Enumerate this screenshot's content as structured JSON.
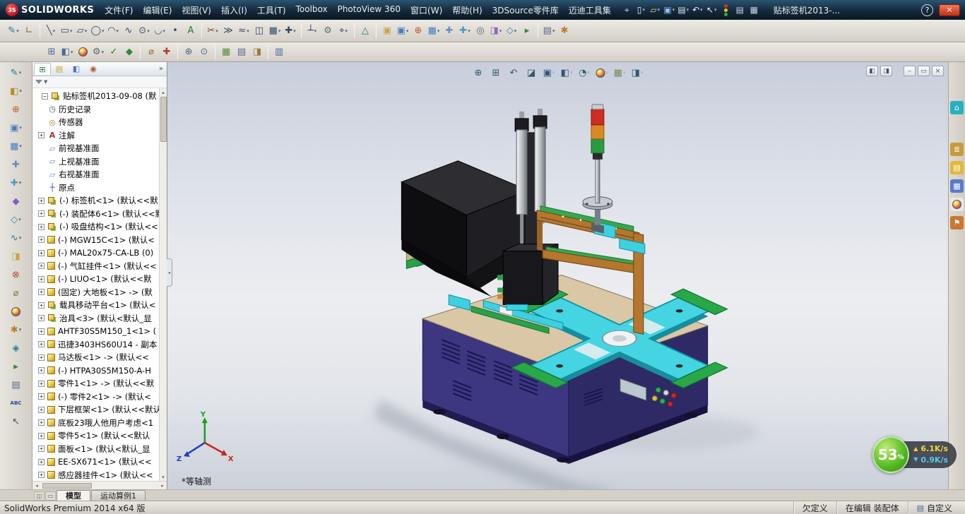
{
  "titlebar": {
    "logo_mark": "3S",
    "logo_text": "SOLIDWORKS",
    "menus": [
      "文件(F)",
      "编辑(E)",
      "视图(V)",
      "插入(I)",
      "工具(T)",
      "Toolbox",
      "PhotoView 360",
      "窗口(W)",
      "帮助(H)",
      "3DSource零件库",
      "迈迪工具集"
    ],
    "quick_icons": [
      {
        "n": "pin-icon",
        "g": "⌖",
        "c": "#cdd6de"
      },
      {
        "n": "new-document-button",
        "g": "▯",
        "c": "#f2f4f6",
        "d": 1
      },
      {
        "n": "open-button",
        "g": "▱",
        "c": "#f0d080",
        "d": 1
      },
      {
        "n": "save-button",
        "g": "▣",
        "c": "#8ec0f0",
        "d": 1
      },
      {
        "n": "print-button",
        "g": "▤",
        "c": "#dfe5ea",
        "d": 1
      },
      {
        "n": "undo-button",
        "g": "↶",
        "c": "#e8eef2",
        "d": 1
      },
      {
        "n": "select-button",
        "g": "↖",
        "c": "#f2f4f6",
        "d": 1
      },
      {
        "n": "rebuild-button",
        "g": "STOPLIGHT",
        "c": ""
      },
      {
        "n": "file-properties-button",
        "g": "▤",
        "c": "#c8d4de"
      },
      {
        "n": "toolbox-browser-button",
        "g": "▦",
        "c": "#c8d4de"
      }
    ],
    "doc_title": "贴标签机2013-...",
    "help_label": "?",
    "close_label": "×"
  },
  "toolbar_row1": [
    {
      "n": "sketch-button",
      "g": "✎",
      "c": "#177a9a",
      "d": 1
    },
    {
      "n": "smart-dimension-button",
      "g": "∟",
      "c": "#8a6a2a"
    },
    {
      "sep": 1
    },
    {
      "n": "line-button",
      "g": "╲",
      "c": "#33486a",
      "d": 1
    },
    {
      "n": "corner-rectangle-button",
      "g": "▭",
      "c": "#33486a",
      "d": 1
    },
    {
      "n": "straight-slot-button",
      "g": "▱",
      "c": "#33486a",
      "d": 1
    },
    {
      "n": "circle-button",
      "g": "◯",
      "c": "#33486a",
      "d": 1
    },
    {
      "n": "centerpoint-arc-button",
      "g": "◠",
      "c": "#33486a",
      "d": 1
    },
    {
      "n": "spline-button",
      "g": "∿",
      "c": "#33486a"
    },
    {
      "n": "ellipse-button",
      "g": "⊙",
      "c": "#33486a",
      "d": 1
    },
    {
      "n": "sketch-fillet-button",
      "g": "◡",
      "c": "#33486a",
      "d": 1
    },
    {
      "n": "point-button",
      "g": "•",
      "c": "#33486a"
    },
    {
      "n": "text-button",
      "g": "A",
      "c": "#2a7a3a"
    },
    {
      "sep": 1
    },
    {
      "n": "trim-entities-button",
      "g": "✂",
      "c": "#8a3a2a",
      "d": 1
    },
    {
      "n": "convert-entities-button",
      "g": "≫",
      "c": "#33486a"
    },
    {
      "n": "offset-entities-button",
      "g": "≈",
      "c": "#33486a",
      "d": 1
    },
    {
      "n": "mirror-entities-button",
      "g": "◫",
      "c": "#33486a"
    },
    {
      "n": "linear-sketch-pattern-button",
      "g": "▦",
      "c": "#33486a",
      "d": 1
    },
    {
      "n": "move-entities-button",
      "g": "✚",
      "c": "#33486a",
      "d": 1
    },
    {
      "sep": 1
    },
    {
      "n": "display-relations-button",
      "g": "┴",
      "c": "#33486a",
      "d": 1
    },
    {
      "n": "repair-sketch-button",
      "g": "⚙",
      "c": "#66707a"
    },
    {
      "n": "quick-snaps-button",
      "g": "⌖",
      "c": "#33486a",
      "d": 1
    },
    {
      "sep": 1
    },
    {
      "n": "rapid-sketch-button",
      "g": "△",
      "c": "#2a7a4a"
    },
    {
      "sep": 1
    },
    {
      "n": "edit-component-button",
      "g": "▣",
      "c": "#caa24a"
    },
    {
      "n": "insert-components-button",
      "g": "▣",
      "c": "#4a7ac0",
      "d": 1
    },
    {
      "n": "mate-button",
      "g": "⊕",
      "c": "#c05a2a"
    },
    {
      "n": "linear-component-pattern-button",
      "g": "▦",
      "c": "#4a7ac0",
      "d": 1
    },
    {
      "n": "smart-fasteners-button",
      "g": "✚",
      "c": "#6a8ac0"
    },
    {
      "n": "move-component-button",
      "g": "✚",
      "c": "#4a9ac0",
      "d": 1
    },
    {
      "n": "show-hidden-components-button",
      "g": "◎",
      "c": "#556070"
    },
    {
      "n": "assembly-features-button",
      "g": "◨",
      "c": "#8a6ac0",
      "d": 1
    },
    {
      "n": "reference-geometry-button",
      "g": "◇",
      "c": "#3a8a9a",
      "d": 1
    },
    {
      "n": "new-motion-study-button",
      "g": "▸",
      "c": "#2a8a3a"
    },
    {
      "sep": 1
    },
    {
      "n": "bill-of-materials-button",
      "g": "▤",
      "c": "#55678a",
      "d": 1
    },
    {
      "n": "exploded-view-button",
      "g": "✱",
      "c": "#c07a2a"
    }
  ],
  "toolbar_row2": [
    {
      "n": "window-layout-button",
      "g": "⊞",
      "c": "#4a6a9a"
    },
    {
      "n": "display-states-button",
      "g": "◧",
      "c": "#4a6a9a",
      "d": 1
    },
    {
      "n": "appearance-ball-button",
      "g": "BALL",
      "c": ""
    },
    {
      "n": "options-gear-button",
      "g": "⚙",
      "c": "#5a6a74",
      "d": 1
    },
    {
      "n": "spell-check-button",
      "g": "✓",
      "c": "#2a7a2a"
    },
    {
      "n": "design-checker-button",
      "g": "◆",
      "c": "#2a8a3a"
    },
    {
      "sep": 1
    },
    {
      "n": "measure-button",
      "g": "⌀",
      "c": "#8a6a2a"
    },
    {
      "n": "mass-properties-button",
      "g": "✚",
      "c": "#b03a2a"
    },
    {
      "sep": 1
    },
    {
      "n": "zoom-button",
      "g": "⊕",
      "c": "#55678a"
    },
    {
      "n": "find-references-button",
      "g": "⊙",
      "c": "#55678a"
    },
    {
      "sep": 1
    },
    {
      "n": "image-capture-button",
      "g": "▦",
      "c": "#5a8a3a"
    },
    {
      "n": "print-preview-button",
      "g": "▤",
      "c": "#55678a"
    },
    {
      "n": "export-button",
      "g": "◨",
      "c": "#9a7a3a"
    },
    {
      "sep": 1
    },
    {
      "n": "help-book-button",
      "g": "▥",
      "c": "#4a6a9a"
    }
  ],
  "left_toolbar": [
    {
      "n": "edit-sketch-button",
      "g": "✎",
      "c": "#177a9a",
      "d": 1
    },
    {
      "n": "features-button",
      "g": "◧",
      "c": "#c08a2a",
      "d": 1
    },
    {
      "n": "mate-tool-button",
      "g": "⊕",
      "c": "#c05a2a"
    },
    {
      "n": "insert-component-button",
      "g": "▣",
      "c": "#4a7ac0",
      "d": 1
    },
    {
      "n": "component-pattern-button",
      "g": "▦",
      "c": "#4a7ac0",
      "d": 1
    },
    {
      "n": "smart-fastener-button",
      "g": "✚",
      "c": "#6a8ac0"
    },
    {
      "n": "move-component-tool-button",
      "g": "✚",
      "c": "#4a9ac0",
      "d": 1
    },
    {
      "n": "smart-components-button",
      "g": "◆",
      "c": "#8a5ac0"
    },
    {
      "n": "reference-geometry-tool-button",
      "g": "◇",
      "c": "#3a8a9a",
      "d": 1
    },
    {
      "n": "curves-button",
      "g": "∿",
      "c": "#3a6a9a",
      "d": 1
    },
    {
      "n": "instant3d-button",
      "g": "◨",
      "c": "#caa24a"
    },
    {
      "n": "interference-detection-button",
      "g": "⊗",
      "c": "#b04a3a"
    },
    {
      "n": "measure-tool-button",
      "g": "⌀",
      "c": "#8a6a2a"
    },
    {
      "n": "appearances-tool-button",
      "g": "BALL",
      "c": ""
    },
    {
      "n": "exploded-view-tool-button",
      "g": "✱",
      "c": "#c07a2a",
      "d": 1
    },
    {
      "n": "simulation-button",
      "g": "◈",
      "c": "#2a7a8a"
    },
    {
      "n": "motion-manager-button",
      "g": "▸",
      "c": "#2a8a3a"
    },
    {
      "n": "bom-tool-button",
      "g": "▤",
      "c": "#55678a"
    },
    {
      "n": "spelling-button",
      "g": "ABC",
      "c": "#2a4a8a"
    },
    {
      "n": "select-tool-button",
      "g": "↖",
      "c": "#44505c"
    }
  ],
  "panel": {
    "tabs": [
      {
        "n": "featuremanager-tab",
        "g": "⊞",
        "c": "#2a7a3a"
      },
      {
        "n": "propertymanager-tab",
        "g": "▤",
        "c": "#caa23a"
      },
      {
        "n": "configurationmanager-tab",
        "g": "◧",
        "c": "#4a7ac0"
      },
      {
        "n": "dimxpertmanager-tab",
        "g": "◉",
        "c": "#b05a2a"
      }
    ],
    "chevron": "»",
    "filter_caret": "▼"
  },
  "tree": {
    "root": {
      "label": "贴标签机2013-09-08 (默",
      "icon": "asm",
      "exp": "-"
    },
    "items": [
      {
        "label": "历史记录",
        "icon": "history"
      },
      {
        "label": "传感器",
        "icon": "sensor"
      },
      {
        "label": "注解",
        "icon": "note",
        "exp": 1
      },
      {
        "label": "前视基准面",
        "icon": "plane"
      },
      {
        "label": "上视基准面",
        "icon": "plane"
      },
      {
        "label": "右视基准面",
        "icon": "plane"
      },
      {
        "label": "原点",
        "icon": "origin"
      },
      {
        "label": "(-) 标签机<1> (默认<<默",
        "icon": "asm",
        "exp": 1
      },
      {
        "label": "(-) 装配体6<1> (默认<<默",
        "icon": "asm",
        "exp": 1
      },
      {
        "label": "(-) 吸盘结构<1> (默认<<",
        "icon": "asm",
        "exp": 1
      },
      {
        "label": "(-) MGW15C<1> (默认<",
        "icon": "part",
        "exp": 1
      },
      {
        "label": "(-) MAL20x75-CA-LB (0)",
        "icon": "part",
        "exp": 1
      },
      {
        "label": "(-) 气缸挂件<1> (默认<<",
        "icon": "part",
        "exp": 1
      },
      {
        "label": "(-) LIUO<1> (默认<<默",
        "icon": "part",
        "exp": 1
      },
      {
        "label": "(固定) 大地板<1> -> (默",
        "icon": "part",
        "exp": 1
      },
      {
        "label": "载具移动平台<1> (默认<",
        "icon": "asm",
        "exp": 1
      },
      {
        "label": "治具<3> (默认<默认_显",
        "icon": "asm",
        "exp": 1
      },
      {
        "label": "AHTF30S5M150_1<1> (",
        "icon": "part",
        "exp": 1
      },
      {
        "label": "迅捷3403HS60U14 - 副本",
        "icon": "part",
        "exp": 1
      },
      {
        "label": "马达板<1> -> (默认<<",
        "icon": "part",
        "exp": 1
      },
      {
        "label": "(-) HTPA30S5M150-A-H",
        "icon": "part",
        "exp": 1
      },
      {
        "label": "零件1<1> -> (默认<<默",
        "icon": "part",
        "exp": 1
      },
      {
        "label": "(-) 零件2<1> -> (默认<",
        "icon": "part",
        "exp": 1
      },
      {
        "label": "下层框架<1> (默认<<默认",
        "icon": "part",
        "exp": 1
      },
      {
        "label": "底板23哦人他用户考虑<1",
        "icon": "part",
        "exp": 1
      },
      {
        "label": "零件5<1> (默认<<默认",
        "icon": "part",
        "exp": 1
      },
      {
        "label": "面板<1> (默认<默认_显",
        "icon": "part",
        "exp": 1
      },
      {
        "label": "EE-SX671<1> (默认<<",
        "icon": "part",
        "exp": 1
      },
      {
        "label": "感应器挂件<1> (默认<<",
        "icon": "part",
        "exp": 1
      }
    ]
  },
  "viewport": {
    "view_label": "*等轴测",
    "triad": {
      "x": "X",
      "y": "Y",
      "z": "Z"
    },
    "headsup": [
      {
        "n": "zoom-fit-icon",
        "g": "⊕",
        "c": "#31586e"
      },
      {
        "n": "zoom-area-icon",
        "g": "⊞",
        "c": "#31586e"
      },
      {
        "n": "previous-view-icon",
        "g": "↶",
        "c": "#31586e"
      },
      {
        "n": "section-view-icon",
        "g": "◪",
        "c": "#31586e"
      },
      {
        "n": "view-orientation-icon",
        "g": "▣",
        "c": "#31586e",
        "d": 1
      },
      {
        "n": "display-style-icon",
        "g": "◧",
        "c": "#31586e",
        "d": 1
      },
      {
        "n": "hide-show-items-icon",
        "g": "◔",
        "c": "#31586e",
        "d": 1
      },
      {
        "n": "edit-appearance-icon",
        "g": "BALL",
        "c": "",
        "d": 1
      },
      {
        "n": "apply-scene-icon",
        "g": "▦",
        "c": "#7a8a5a",
        "d": 1
      },
      {
        "n": "view-settings-icon",
        "g": "◨",
        "c": "#31586e",
        "d": 1
      }
    ],
    "doc_controls": [
      {
        "n": "pane-split-left-icon",
        "g": "◧"
      },
      {
        "n": "pane-split-right-icon",
        "g": "◨"
      },
      {
        "gap": 1
      },
      {
        "n": "doc-minimize-button",
        "g": "–"
      },
      {
        "n": "doc-restore-button",
        "g": "▭"
      },
      {
        "n": "doc-close-button",
        "g": "×"
      }
    ]
  },
  "task_pane": [
    {
      "n": "solidworks-resources-icon",
      "g": "⌂",
      "bg": "#28b0c0"
    },
    {
      "n": "design-library-icon",
      "g": "≣",
      "bg": "#c89a3a"
    },
    {
      "n": "file-explorer-icon",
      "g": "▤",
      "bg": "#e0b83a"
    },
    {
      "n": "view-palette-icon",
      "g": "▦",
      "bg": "#5a7ac8"
    },
    {
      "n": "appearances-icon",
      "g": "BALL",
      "bg": "#e8e8ec"
    },
    {
      "n": "custom-properties-icon",
      "g": "⚑",
      "bg": "#c87830"
    }
  ],
  "bottom_tabs": {
    "controls": [
      {
        "n": "splitter-horizontal-button",
        "g": "◫"
      },
      {
        "n": "splitter-vertical-button",
        "g": "▭"
      }
    ],
    "tabs": [
      {
        "label": "模型",
        "active": true
      },
      {
        "label": "运动算例1",
        "active": false
      }
    ]
  },
  "statusbar": {
    "product": "SolidWorks Premium 2014 x64 版",
    "cells": [
      "欠定义",
      "在编辑 装配体",
      "自定义"
    ]
  },
  "overlay": {
    "percent": "53",
    "unit": "%",
    "up_speed": "6.1K/s",
    "down_speed": "0.9K/s"
  }
}
